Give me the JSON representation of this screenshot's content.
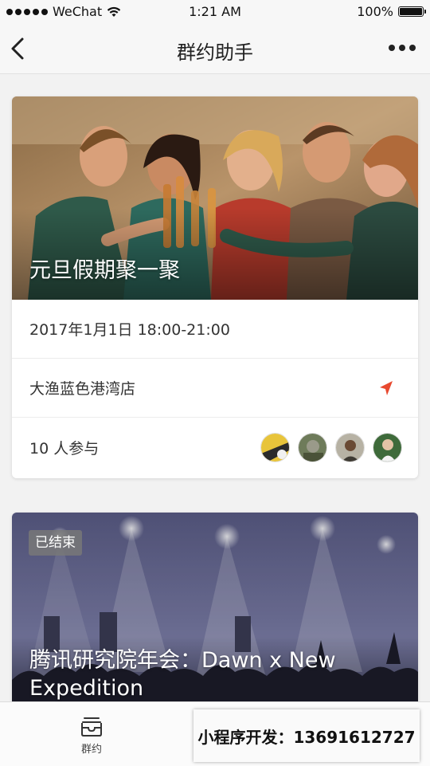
{
  "status_bar": {
    "carrier": "WeChat",
    "time": "1:21 AM",
    "battery": "100%",
    "battery_level": 1.0
  },
  "nav": {
    "title": "群约助手"
  },
  "events": [
    {
      "title": "元旦假期聚一聚",
      "datetime": "2017年1月1日 18:00-21:00",
      "location": "大渔蓝色港湾店",
      "participants": "10 人参与",
      "accent_color": "#e8492f"
    },
    {
      "badge": "已结束",
      "title": "腾讯研究院年会：Dawn x New Expedition"
    }
  ],
  "tab_bar": {
    "tabs": [
      {
        "label": "群约",
        "icon": "inbox-tray-icon"
      }
    ]
  },
  "contact": {
    "text": "小程序开发：13691612727"
  }
}
